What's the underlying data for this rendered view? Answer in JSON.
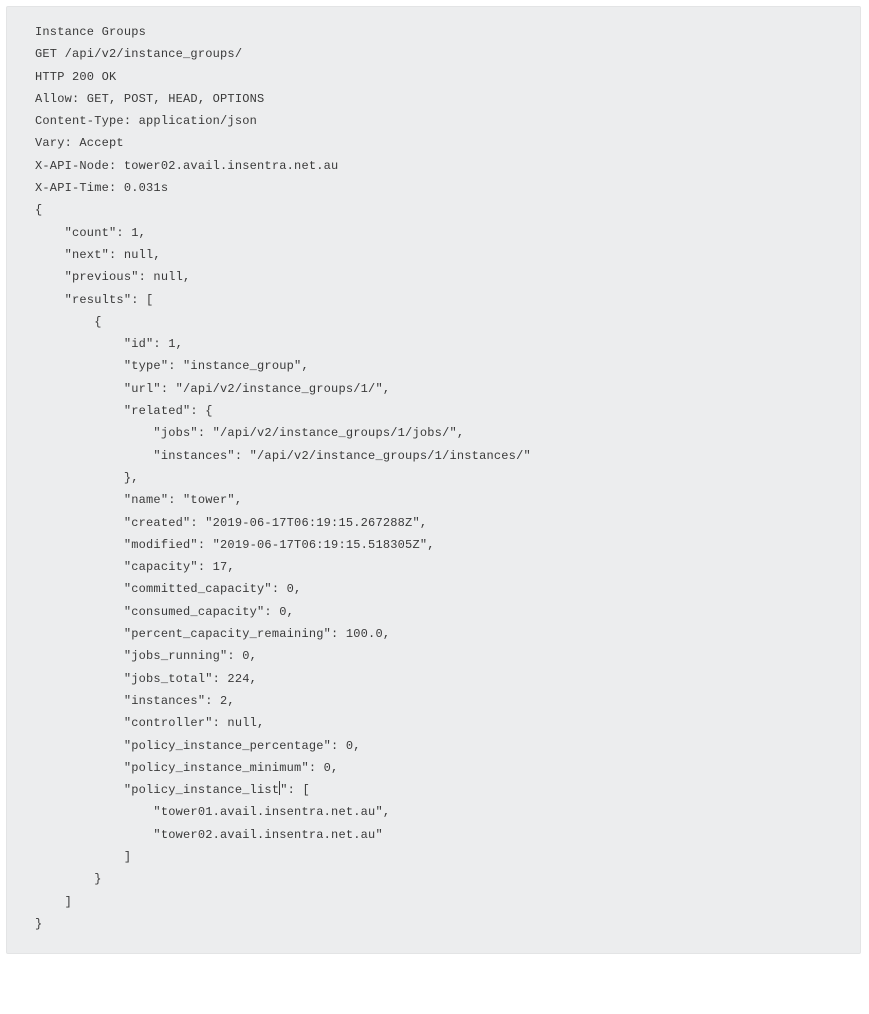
{
  "lines": {
    "l00": "Instance Groups",
    "l01": "GET /api/v2/instance_groups/",
    "l02": "HTTP 200 OK",
    "l03": "Allow: GET, POST, HEAD, OPTIONS",
    "l04": "Content-Type: application/json",
    "l05": "Vary: Accept",
    "l06": "X-API-Node: tower02.avail.insentra.net.au",
    "l07": "X-API-Time: 0.031s",
    "l08": "",
    "l09": "",
    "l10": "",
    "l11": "{",
    "l12": "    \"count\": 1,",
    "l13": "    \"next\": null,",
    "l14": "    \"previous\": null,",
    "l15": "    \"results\": [",
    "l16": "        {",
    "l17": "            \"id\": 1,",
    "l18": "            \"type\": \"instance_group\",",
    "l19": "            \"url\": \"/api/v2/instance_groups/1/\",",
    "l20": "            \"related\": {",
    "l21": "                \"jobs\": \"/api/v2/instance_groups/1/jobs/\",",
    "l22": "                \"instances\": \"/api/v2/instance_groups/1/instances/\"",
    "l23": "            },",
    "l24": "            \"name\": \"tower\",",
    "l25": "            \"created\": \"2019-06-17T06:19:15.267288Z\",",
    "l26": "            \"modified\": \"2019-06-17T06:19:15.518305Z\",",
    "l27": "            \"capacity\": 17,",
    "l28": "            \"committed_capacity\": 0,",
    "l29": "            \"consumed_capacity\": 0,",
    "l30": "            \"percent_capacity_remaining\": 100.0,",
    "l31": "            \"jobs_running\": 0,",
    "l32": "            \"jobs_total\": 224,",
    "l33": "            \"instances\": 2,",
    "l34": "            \"controller\": null,",
    "l35": "            \"policy_instance_percentage\": 0,",
    "l36": "            \"policy_instance_minimum\": 0,",
    "l37a": "            \"policy_instance_list",
    "l37b": "\": [",
    "l38": "                \"tower01.avail.insentra.net.au\",",
    "l39": "                \"tower02.avail.insentra.net.au\"",
    "l40": "            ]",
    "l41": "        }",
    "l42": "    ]",
    "l43": "}"
  }
}
